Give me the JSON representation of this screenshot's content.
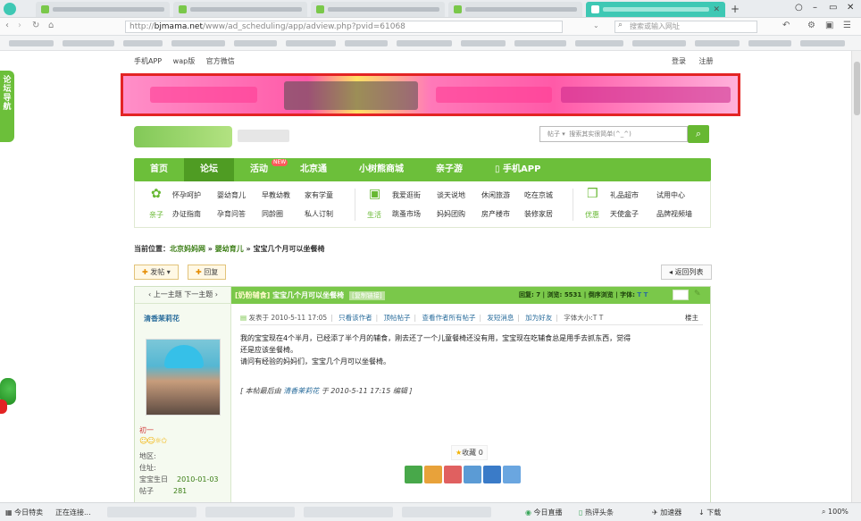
{
  "browser": {
    "tabs": [
      {
        "label": "",
        "active": false
      },
      {
        "label": "",
        "active": false
      },
      {
        "label": "",
        "active": false
      },
      {
        "label": "",
        "active": false
      },
      {
        "label": "",
        "active": true
      }
    ],
    "new_tab": "+",
    "url_protocol": "http://",
    "url_domain": "bjmama.net",
    "url_path": "/www/ad_scheduling/app/adview.php?pvid=61068",
    "search_placeholder": "搜索或输入网址",
    "reload_icon": "reload-icon",
    "home_icon": "home-icon"
  },
  "site": {
    "top_links": [
      "手机APP",
      "wap版",
      "官方微信"
    ],
    "login_links": [
      "登录",
      "注册"
    ],
    "search_category": "帖子",
    "search_placeholder": "搜索其实很简单(^_^)",
    "float_nav": "论坛导航",
    "main_nav": [
      {
        "label": "首页",
        "active": false
      },
      {
        "label": "论坛",
        "active": true
      },
      {
        "label": "活动",
        "active": false,
        "badge": "NEW"
      },
      {
        "label": "北京通",
        "active": false
      },
      {
        "label": "小树熊商城",
        "active": false
      },
      {
        "label": "亲子游",
        "active": false
      },
      {
        "label": "手机APP",
        "active": false
      }
    ],
    "sub_groups": [
      {
        "label": "亲子",
        "items": [
          [
            "怀孕呵护",
            "婴幼育儿",
            "早教幼教",
            "家有学童"
          ],
          [
            "办证指南",
            "孕育问答",
            "同龄圈",
            "私人订制"
          ]
        ]
      },
      {
        "label": "生活",
        "items": [
          [
            "我爱逛街",
            "谈天说地",
            "休闲旅游",
            "吃在京城"
          ],
          [
            "跳蚤市场",
            "妈妈团购",
            "房产楼市",
            "装修家居"
          ]
        ]
      },
      {
        "label": "优惠",
        "items": [
          [
            "礼品超市",
            "试用中心"
          ],
          [
            "天使盒子",
            "品牌视频墙"
          ]
        ]
      }
    ]
  },
  "breadcrumb": {
    "prefix": "当前位置：",
    "items": [
      "北京妈妈网",
      "婴幼育儿",
      "宝宝几个月可以坐餐椅"
    ],
    "sep": " » "
  },
  "actions": {
    "post": "发帖",
    "reply": "回复",
    "back": "返回列表"
  },
  "thread": {
    "prev_next": "上一主题  下一主题",
    "tag": "[奶粉辅食]",
    "title": "宝宝几个月可以坐餐椅",
    "copy_link": "[复制链接]",
    "replies_label": "回复:",
    "replies": "7",
    "views_label": "浏览:",
    "views": "5531",
    "mode": "倒序浏览",
    "font_label": "字体:",
    "font_t": "T T",
    "author": "清香茉莉花",
    "level": "初一",
    "stars": "☺☺☼✩",
    "user_info": [
      {
        "k": "地区",
        "v": ""
      },
      {
        "k": "住址",
        "v": ""
      },
      {
        "k": "宝宝生日",
        "v": "2010-01-03"
      },
      {
        "k": "帖子",
        "v": "281"
      }
    ],
    "posted_at": "发表于 2010-5-11 17:05",
    "meta_links": [
      "只看该作者",
      "顶帖帖子",
      "查看作者所有帖子",
      "发短消息",
      "加为好友",
      "字体大小:T T"
    ],
    "floor": "楼主",
    "body_lines": [
      "我的宝宝现在4个半月，已经添了半个月的辅食，刚去还了一个儿童餐椅还没有用，宝宝现在吃辅食总是用手去抓东西，觉得",
      "还是应该坐餐椅。",
      "请问有经验的妈妈们，宝宝几个月可以坐餐椅。"
    ],
    "edited_prefix": "[ 本帖最后由 ",
    "edited_name": "清香茉莉花",
    "edited_suffix": " 于 2010-5-11 17:15 编辑 ]",
    "fav_label": "收藏",
    "fav_count": "0"
  },
  "statusbar": {
    "left": [
      "今日特卖",
      "正在连接..."
    ],
    "right": [
      "今日直播",
      "热评头条",
      "加速器",
      "下载",
      "100%"
    ]
  },
  "colors": {
    "brand_green": "#6cbf3a",
    "banner_border": "#e32424",
    "banner_pink": "#ff5aa8"
  }
}
